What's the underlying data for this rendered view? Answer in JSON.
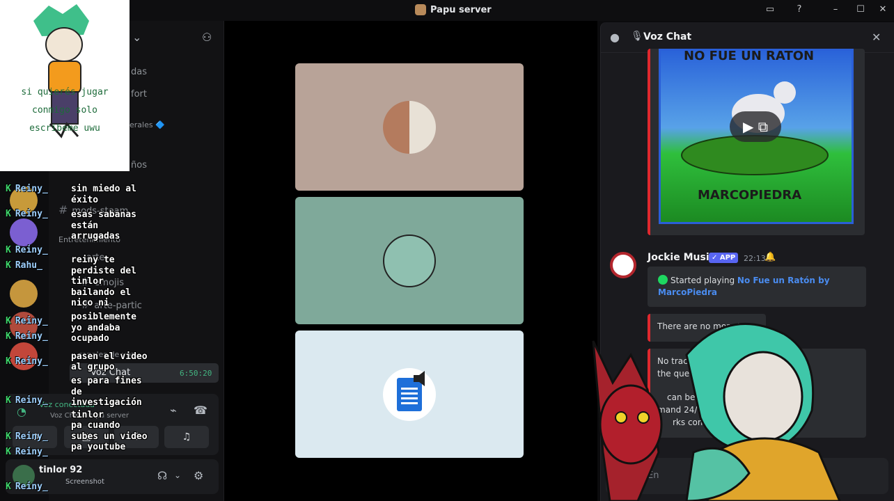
{
  "window": {
    "title": "Papu server",
    "controls": [
      "inbox-icon",
      "help-icon",
      "minimize-icon",
      "maximize-icon",
      "close-icon"
    ]
  },
  "overlay": {
    "caption_lines": [
      "si quierés jugar",
      "conmigo solo",
      "escribeme uwu"
    ]
  },
  "sidebar": {
    "partial_channels": [
      "das",
      "fort",
      "erales 🔷",
      "ños"
    ],
    "channels": [
      "mods-steam",
      "arte",
      "emojis",
      "arte-partic"
    ],
    "categories": [
      "Entretenimiento",
      "canales de voz"
    ],
    "voice_channel": "Voz Chat",
    "timer": "6:50:20",
    "voice_status": "Voz conectada",
    "voice_location": "Voz Chat / Papu server",
    "user": {
      "name": "tinlor 92",
      "status": "Screenshot"
    }
  },
  "stream_chat": {
    "names": [
      "Reiny_",
      "Reiny_",
      "Reiny_",
      "Rahu_",
      "Reiny_",
      "Reiny_",
      "Reiny_",
      "Reiny_",
      "Reiny_",
      "Reiny_",
      "Reiny_"
    ],
    "lines": [
      "sin miedo al",
      "éxito",
      "esas sabanas",
      "están",
      "arrugadas",
      "reiny te",
      "perdiste del",
      "tinlor",
      "bailando el",
      "nico ni",
      "posiblemente",
      "yo andaba",
      "ocupado",
      "pasen el video",
      "al grupo",
      "es para fines",
      "de",
      "investigación",
      "tinlor",
      "pa cuando",
      "subes un video",
      "pa youtube"
    ]
  },
  "right_panel": {
    "title": "Voz Chat",
    "thumb_top": "NO FUE UN RATON",
    "thumb_bottom": "MARCOPIEDRA",
    "bot": {
      "name": "Jockie Music",
      "tag": "✓ APP",
      "time": "22:13"
    },
    "embed1": {
      "prefix": "Started playing",
      "song": "No Fue un Ratón by MarcoPiedra"
    },
    "embed2": "There are no more tr",
    "embed3_lines": [
      "No tracks have been pla",
      "the queue, leaving 👋",
      "can be disabled by us",
      "mand 24/7, for m",
      "rks comm"
    ],
    "composer_placeholder": "En"
  }
}
